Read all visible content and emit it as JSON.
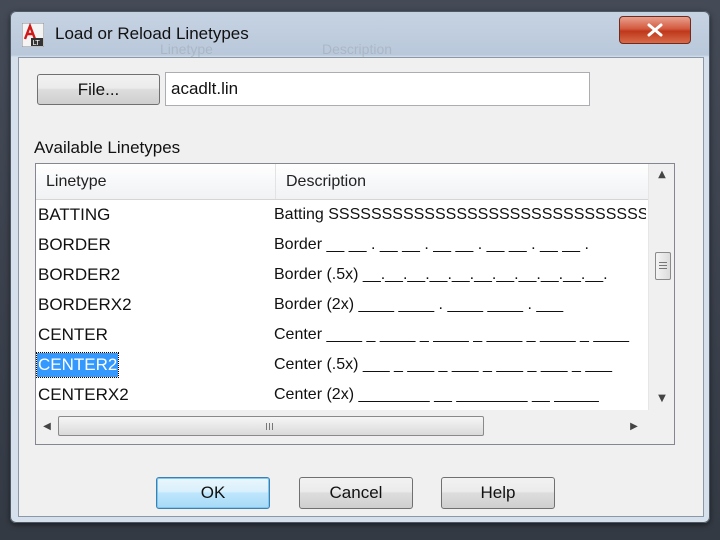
{
  "window": {
    "title": "Load or Reload Linetypes",
    "ghost_header_left": "Linetype",
    "ghost_header_right": "Description",
    "close_icon": "close-icon"
  },
  "file": {
    "button_label": "File...",
    "filename": "acadlt.lin"
  },
  "list": {
    "label": "Available Linetypes",
    "columns": [
      "Linetype",
      "Description"
    ],
    "rows": [
      {
        "name": "BATTING",
        "description": "Batting SSSSSSSSSSSSSSSSSSSSSSSSSSSSSSS",
        "selected": false
      },
      {
        "name": "BORDER",
        "description": "Border __ __ . __ __ . __ __ . __ __ . __ __ .",
        "selected": false
      },
      {
        "name": "BORDER2",
        "description": "Border (.5x) __.__.__.__.__.__.__.__.__.__.__.",
        "selected": false
      },
      {
        "name": "BORDERX2",
        "description": "Border (2x) ____ ____ . ____ ____ . ___",
        "selected": false
      },
      {
        "name": "CENTER",
        "description": "Center ____ _ ____ _ ____ _ ____ _ ____ _ ____",
        "selected": false
      },
      {
        "name": "CENTER2",
        "description": "Center (.5x) ___ _ ___ _ ___ _ ___ _ ___ _ ___",
        "selected": true
      },
      {
        "name": "CENTERX2",
        "description": "Center (2x) ________  __  ________  __  _____",
        "selected": false
      }
    ],
    "scroll": {
      "up_icon": "arrow-up-icon",
      "down_icon": "arrow-down-icon",
      "left_icon": "arrow-left-icon",
      "right_icon": "arrow-right-icon"
    }
  },
  "buttons": {
    "ok": "OK",
    "cancel": "Cancel",
    "help": "Help"
  },
  "colors": {
    "selection": "#3399ff",
    "close_button": "#c0381c",
    "default_button_border": "#3c7fb1"
  }
}
